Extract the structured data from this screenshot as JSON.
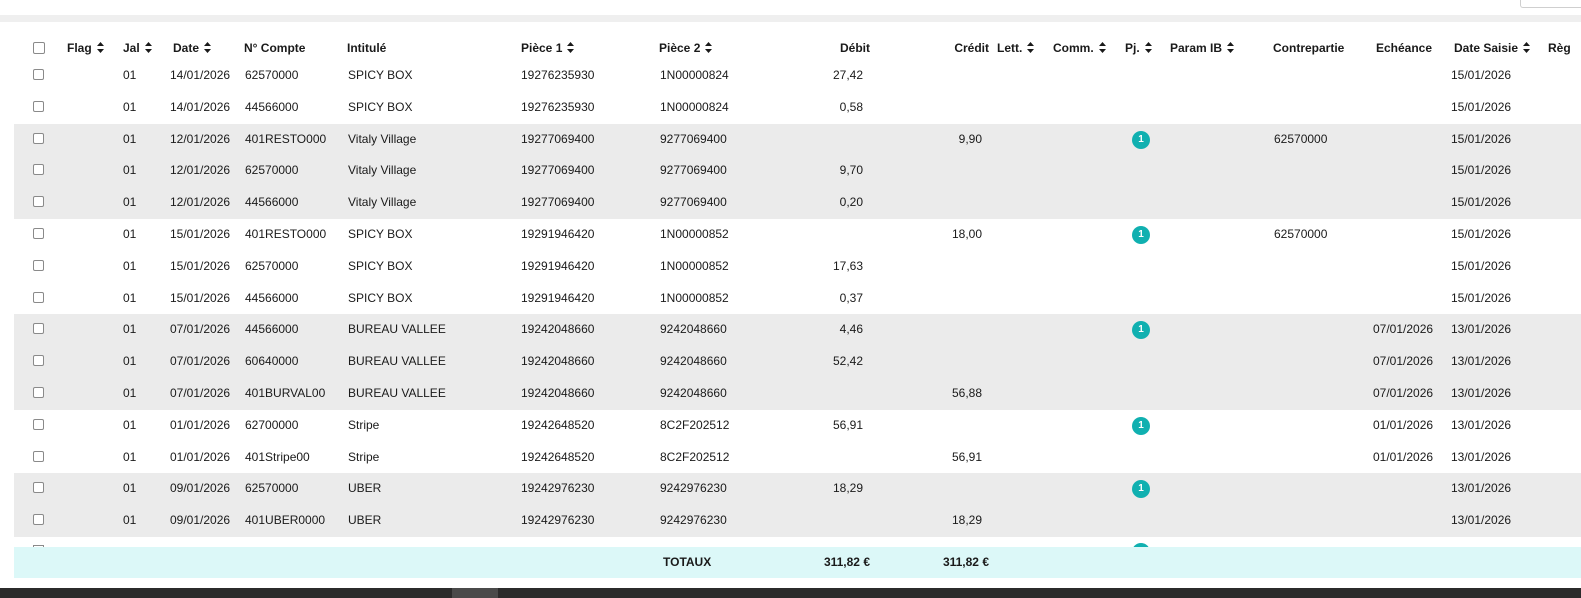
{
  "columns": {
    "flag": "Flag",
    "jal": "Jal",
    "date": "Date",
    "compte": "N° Compte",
    "intitule": "Intitulé",
    "piece1": "Pièce 1",
    "piece2": "Pièce 2",
    "debit": "Débit",
    "credit": "Crédit",
    "lett": "Lett.",
    "comm": "Comm.",
    "pj": "Pj.",
    "paramib": "Param IB",
    "contrepartie": "Contrepartie",
    "echeance": "Echéance",
    "datesaisie": "Date Saisie",
    "reg": "Règ"
  },
  "rows": [
    {
      "jal": "01",
      "date": "14/01/2026",
      "compte": "62570000",
      "intitule": "SPICY BOX",
      "piece1": "19276235930",
      "piece2": "1N00000824",
      "debit": "27,42",
      "credit": "",
      "pj": "",
      "contrepartie": "",
      "echeance": "",
      "datesaisie": "15/01/2026",
      "shade": false
    },
    {
      "jal": "01",
      "date": "14/01/2026",
      "compte": "44566000",
      "intitule": "SPICY BOX",
      "piece1": "19276235930",
      "piece2": "1N00000824",
      "debit": "0,58",
      "credit": "",
      "pj": "",
      "contrepartie": "",
      "echeance": "",
      "datesaisie": "15/01/2026",
      "shade": false
    },
    {
      "jal": "01",
      "date": "12/01/2026",
      "compte": "401RESTO000",
      "intitule": "Vitaly Village",
      "piece1": "19277069400",
      "piece2": "9277069400",
      "debit": "",
      "credit": "9,90",
      "pj": "1",
      "contrepartie": "62570000",
      "echeance": "",
      "datesaisie": "15/01/2026",
      "shade": true
    },
    {
      "jal": "01",
      "date": "12/01/2026",
      "compte": "62570000",
      "intitule": "Vitaly Village",
      "piece1": "19277069400",
      "piece2": "9277069400",
      "debit": "9,70",
      "credit": "",
      "pj": "",
      "contrepartie": "",
      "echeance": "",
      "datesaisie": "15/01/2026",
      "shade": true
    },
    {
      "jal": "01",
      "date": "12/01/2026",
      "compte": "44566000",
      "intitule": "Vitaly Village",
      "piece1": "19277069400",
      "piece2": "9277069400",
      "debit": "0,20",
      "credit": "",
      "pj": "",
      "contrepartie": "",
      "echeance": "",
      "datesaisie": "15/01/2026",
      "shade": true
    },
    {
      "jal": "01",
      "date": "15/01/2026",
      "compte": "401RESTO000",
      "intitule": "SPICY BOX",
      "piece1": "19291946420",
      "piece2": "1N00000852",
      "debit": "",
      "credit": "18,00",
      "pj": "1",
      "contrepartie": "62570000",
      "echeance": "",
      "datesaisie": "15/01/2026",
      "shade": false
    },
    {
      "jal": "01",
      "date": "15/01/2026",
      "compte": "62570000",
      "intitule": "SPICY BOX",
      "piece1": "19291946420",
      "piece2": "1N00000852",
      "debit": "17,63",
      "credit": "",
      "pj": "",
      "contrepartie": "",
      "echeance": "",
      "datesaisie": "15/01/2026",
      "shade": false
    },
    {
      "jal": "01",
      "date": "15/01/2026",
      "compte": "44566000",
      "intitule": "SPICY BOX",
      "piece1": "19291946420",
      "piece2": "1N00000852",
      "debit": "0,37",
      "credit": "",
      "pj": "",
      "contrepartie": "",
      "echeance": "",
      "datesaisie": "15/01/2026",
      "shade": false
    },
    {
      "jal": "01",
      "date": "07/01/2026",
      "compte": "44566000",
      "intitule": "BUREAU VALLEE",
      "piece1": "19242048660",
      "piece2": "9242048660",
      "debit": "4,46",
      "credit": "",
      "pj": "1",
      "contrepartie": "",
      "echeance": "07/01/2026",
      "datesaisie": "13/01/2026",
      "shade": true
    },
    {
      "jal": "01",
      "date": "07/01/2026",
      "compte": "60640000",
      "intitule": "BUREAU VALLEE",
      "piece1": "19242048660",
      "piece2": "9242048660",
      "debit": "52,42",
      "credit": "",
      "pj": "",
      "contrepartie": "",
      "echeance": "07/01/2026",
      "datesaisie": "13/01/2026",
      "shade": true
    },
    {
      "jal": "01",
      "date": "07/01/2026",
      "compte": "401BURVAL00",
      "intitule": "BUREAU VALLEE",
      "piece1": "19242048660",
      "piece2": "9242048660",
      "debit": "",
      "credit": "56,88",
      "pj": "",
      "contrepartie": "",
      "echeance": "07/01/2026",
      "datesaisie": "13/01/2026",
      "shade": true
    },
    {
      "jal": "01",
      "date": "01/01/2026",
      "compte": "62700000",
      "intitule": "Stripe",
      "piece1": "19242648520",
      "piece2": "8C2F202512",
      "debit": "56,91",
      "credit": "",
      "pj": "1",
      "contrepartie": "",
      "echeance": "01/01/2026",
      "datesaisie": "13/01/2026",
      "shade": false
    },
    {
      "jal": "01",
      "date": "01/01/2026",
      "compte": "401Stripe00",
      "intitule": "Stripe",
      "piece1": "19242648520",
      "piece2": "8C2F202512",
      "debit": "",
      "credit": "56,91",
      "pj": "",
      "contrepartie": "",
      "echeance": "01/01/2026",
      "datesaisie": "13/01/2026",
      "shade": false
    },
    {
      "jal": "01",
      "date": "09/01/2026",
      "compte": "62570000",
      "intitule": "UBER",
      "piece1": "19242976230",
      "piece2": "9242976230",
      "debit": "18,29",
      "credit": "",
      "pj": "1",
      "contrepartie": "",
      "echeance": "",
      "datesaisie": "13/01/2026",
      "shade": true
    },
    {
      "jal": "01",
      "date": "09/01/2026",
      "compte": "401UBER0000",
      "intitule": "UBER",
      "piece1": "19242976230",
      "piece2": "9242976230",
      "debit": "",
      "credit": "18,29",
      "pj": "",
      "contrepartie": "",
      "echeance": "",
      "datesaisie": "13/01/2026",
      "shade": true
    }
  ],
  "totals": {
    "label": "TOTAUX",
    "debit": "311,82 €",
    "credit": "311,82 €"
  },
  "colors": {
    "badge": "#10b0b0",
    "row_shade": "#ebebeb",
    "totals_bg": "#dcf8f8"
  },
  "icons": {
    "sort": "sort-arrows-icon",
    "pj_badge": "attachment-count-badge"
  }
}
